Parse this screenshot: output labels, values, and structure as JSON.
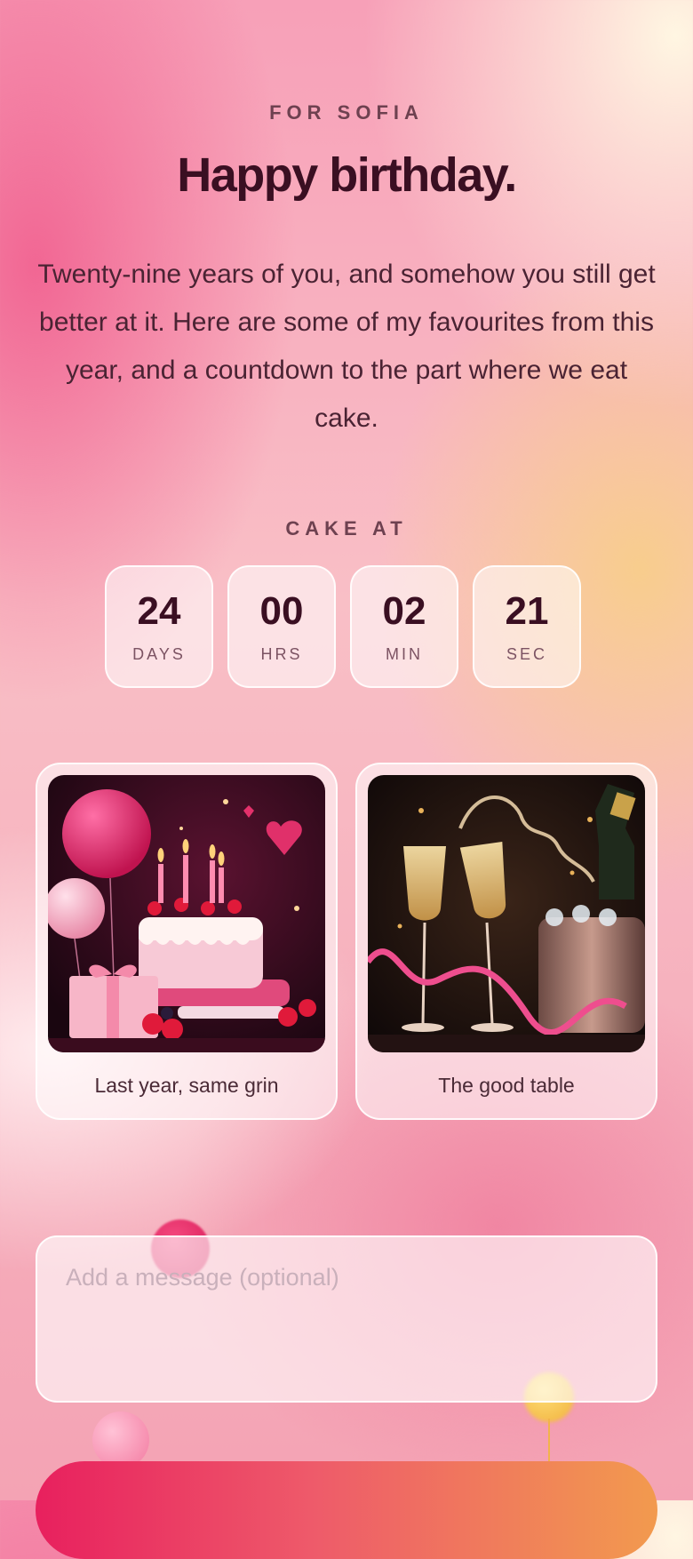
{
  "header": {
    "eyebrow": "FOR SOFIA",
    "title": "Happy birthday.",
    "intro": "Twenty-nine years of you, and somehow you still get better at it. Here are some of my favourites from this year, and a countdown to the part where we eat cake."
  },
  "countdown": {
    "label": "CAKE AT",
    "units": [
      {
        "value": "24",
        "label": "DAYS"
      },
      {
        "value": "00",
        "label": "HRS"
      },
      {
        "value": "02",
        "label": "MIN"
      },
      {
        "value": "21",
        "label": "SEC"
      }
    ]
  },
  "photos": [
    {
      "caption": "Last year, same grin",
      "image": "birthday-cake-with-balloons"
    },
    {
      "caption": "The good table",
      "image": "champagne-toast"
    }
  ],
  "message": {
    "placeholder": "Add a message (optional)",
    "value": ""
  },
  "colors": {
    "accent_start": "#e8205e",
    "accent_end": "#f29a4e",
    "title": "#3a0f22"
  }
}
